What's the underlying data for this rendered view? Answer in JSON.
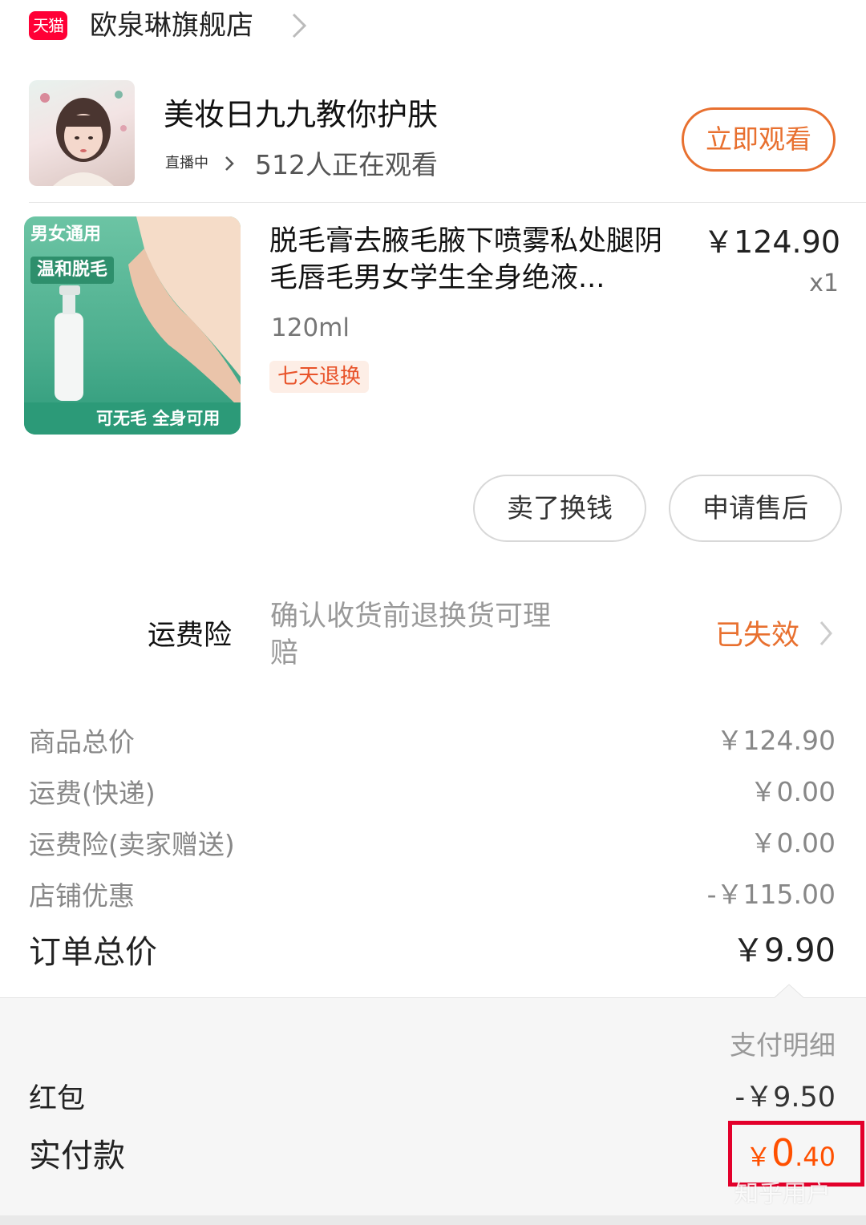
{
  "store": {
    "badge": "天猫",
    "name": "欧泉琳旗舰店"
  },
  "live": {
    "title": "美妆日九九教你护肤",
    "status": "直播中",
    "viewers": "512人正在观看",
    "watch_button": "立即观看"
  },
  "product": {
    "title": "脱毛膏去腋毛腋下喷雾私处腿阴毛唇毛男女学生全身绝液...",
    "spec": "120ml",
    "badge": "七天退换",
    "price": "￥124.90",
    "qty": "x1",
    "image_tags": {
      "tag1": "男女通用",
      "tag2": "温和脱毛",
      "bottom": "可无毛 全身可用"
    }
  },
  "actions": {
    "sell": "卖了换钱",
    "aftersale": "申请售后"
  },
  "insurance": {
    "label": "运费险",
    "desc": "确认收货前退换货可理赔",
    "status": "已失效"
  },
  "price_rows": [
    {
      "label": "商品总价",
      "value": "￥124.90"
    },
    {
      "label": "运费(快递)",
      "value": "￥0.00"
    },
    {
      "label": "运费险(卖家赠送)",
      "value": "￥0.00"
    },
    {
      "label": "店铺优惠",
      "value": "-￥115.00"
    }
  ],
  "total": {
    "label": "订单总价",
    "value": "￥9.90"
  },
  "payment": {
    "detail_link": "支付明细",
    "red_packet_label": "红包",
    "red_packet_value": "-￥9.50",
    "paid_label": "实付款",
    "paid_currency": "￥",
    "paid_integer": "0",
    "paid_decimal": ".40"
  },
  "watermark": "知乎用户",
  "colors": {
    "accent": "#e8702f",
    "tmall_red": "#ff0036",
    "highlight_box": "#e3002b",
    "paid": "#ff5000"
  }
}
